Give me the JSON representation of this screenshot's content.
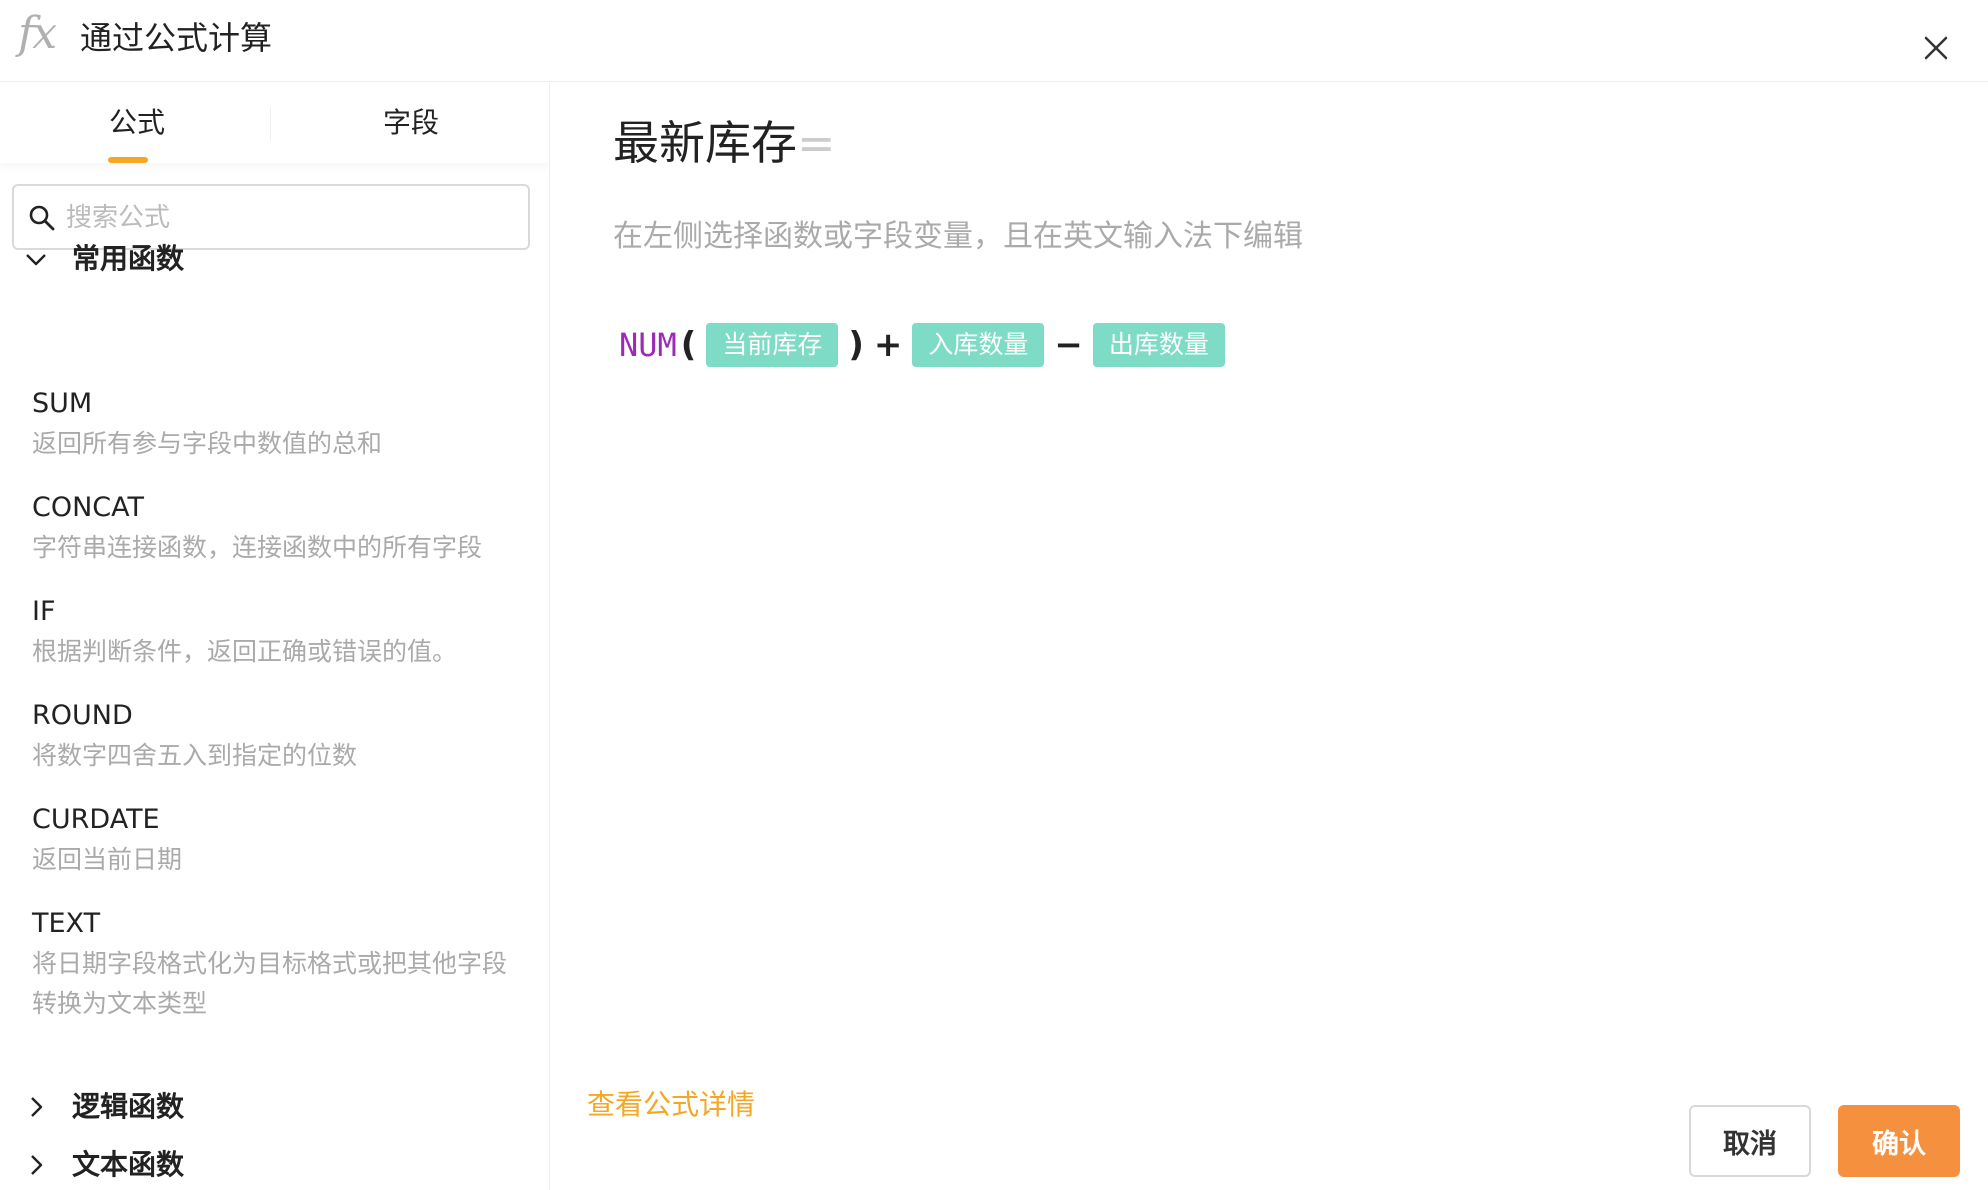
{
  "header": {
    "icon_text": "fx",
    "title": "通过公式计算"
  },
  "sidebar": {
    "tabs": [
      {
        "label": "公式",
        "active": true
      },
      {
        "label": "字段",
        "active": false
      }
    ],
    "search": {
      "placeholder": "搜索公式",
      "value": ""
    },
    "groups": [
      {
        "label": "常用函数",
        "expanded": true,
        "functions": [
          {
            "name": "SUM",
            "desc": "返回所有参与字段中数值的总和"
          },
          {
            "name": "CONCAT",
            "desc": "字符串连接函数，连接函数中的所有字段"
          },
          {
            "name": "IF",
            "desc": "根据判断条件，返回正确或错误的值。"
          },
          {
            "name": "ROUND",
            "desc": "将数字四舍五入到指定的位数"
          },
          {
            "name": "CURDATE",
            "desc": "返回当前日期"
          },
          {
            "name": "TEXT",
            "desc": "将日期字段格式化为目标格式或把其他字段转换为文本类型"
          }
        ]
      },
      {
        "label": "逻辑函数",
        "expanded": false
      },
      {
        "label": "文本函数",
        "expanded": false
      }
    ]
  },
  "editor": {
    "field_name": "最新库存",
    "equals": "=",
    "hint": "在左侧选择函数或字段变量，且在英文输入法下编辑",
    "formula": {
      "function": "NUM",
      "open_paren": "(",
      "close_paren": ")",
      "plus": "+",
      "minus": "−",
      "fields": [
        "当前库存",
        "入库数量",
        "出库数量"
      ]
    }
  },
  "footer": {
    "detail_link": "查看公式详情",
    "cancel_label": "取消",
    "confirm_label": "确认"
  },
  "colors": {
    "accent": "#f5a623",
    "confirm_button": "#f5903f",
    "field_tag": "#7ddbc6",
    "function_token": "#9b2ab8"
  }
}
